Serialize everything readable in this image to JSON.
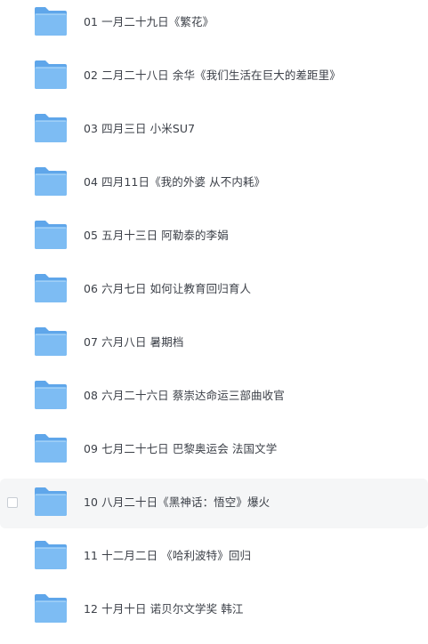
{
  "files": [
    {
      "name": "01 一月二十九日《繁花》",
      "type": "folder",
      "icon": "folder-icon",
      "selected": false,
      "hovered": false
    },
    {
      "name": "02 二月二十八日 余华《我们生活在巨大的差距里》",
      "type": "folder",
      "icon": "folder-icon",
      "selected": false,
      "hovered": false
    },
    {
      "name": "03 四月三日 小米SU7",
      "type": "folder",
      "icon": "folder-icon",
      "selected": false,
      "hovered": false
    },
    {
      "name": "04 四月11日《我的外婆 从不内耗》",
      "type": "folder",
      "icon": "folder-icon",
      "selected": false,
      "hovered": false
    },
    {
      "name": "05 五月十三日 阿勒泰的李娟",
      "type": "folder",
      "icon": "folder-icon",
      "selected": false,
      "hovered": false
    },
    {
      "name": "06 六月七日 如何让教育回归育人",
      "type": "folder",
      "icon": "folder-icon",
      "selected": false,
      "hovered": false
    },
    {
      "name": "07 六月八日 暑期档",
      "type": "folder",
      "icon": "folder-icon",
      "selected": false,
      "hovered": false
    },
    {
      "name": "08 六月二十六日 蔡崇达命运三部曲收官",
      "type": "folder",
      "icon": "folder-icon",
      "selected": false,
      "hovered": false
    },
    {
      "name": "09 七月二十七日 巴黎奥运会 法国文学",
      "type": "folder",
      "icon": "folder-icon",
      "selected": false,
      "hovered": false
    },
    {
      "name": "10 八月二十日《黑神话：悟空》爆火",
      "type": "folder",
      "icon": "folder-icon",
      "selected": false,
      "hovered": true
    },
    {
      "name": "11 十二月二日 《哈利波特》回归",
      "type": "folder",
      "icon": "folder-icon",
      "selected": false,
      "hovered": false
    },
    {
      "name": "12 十月十日 诺贝尔文学奖 韩江",
      "type": "folder",
      "icon": "folder-icon",
      "selected": false,
      "hovered": false
    }
  ],
  "colors": {
    "folder_back": "#5fa6ea",
    "folder_front": "#7dbcf3",
    "folder_highlight": "#a9d4f8",
    "text": "#3c4048",
    "hover_bg": "#f5f6f7"
  }
}
